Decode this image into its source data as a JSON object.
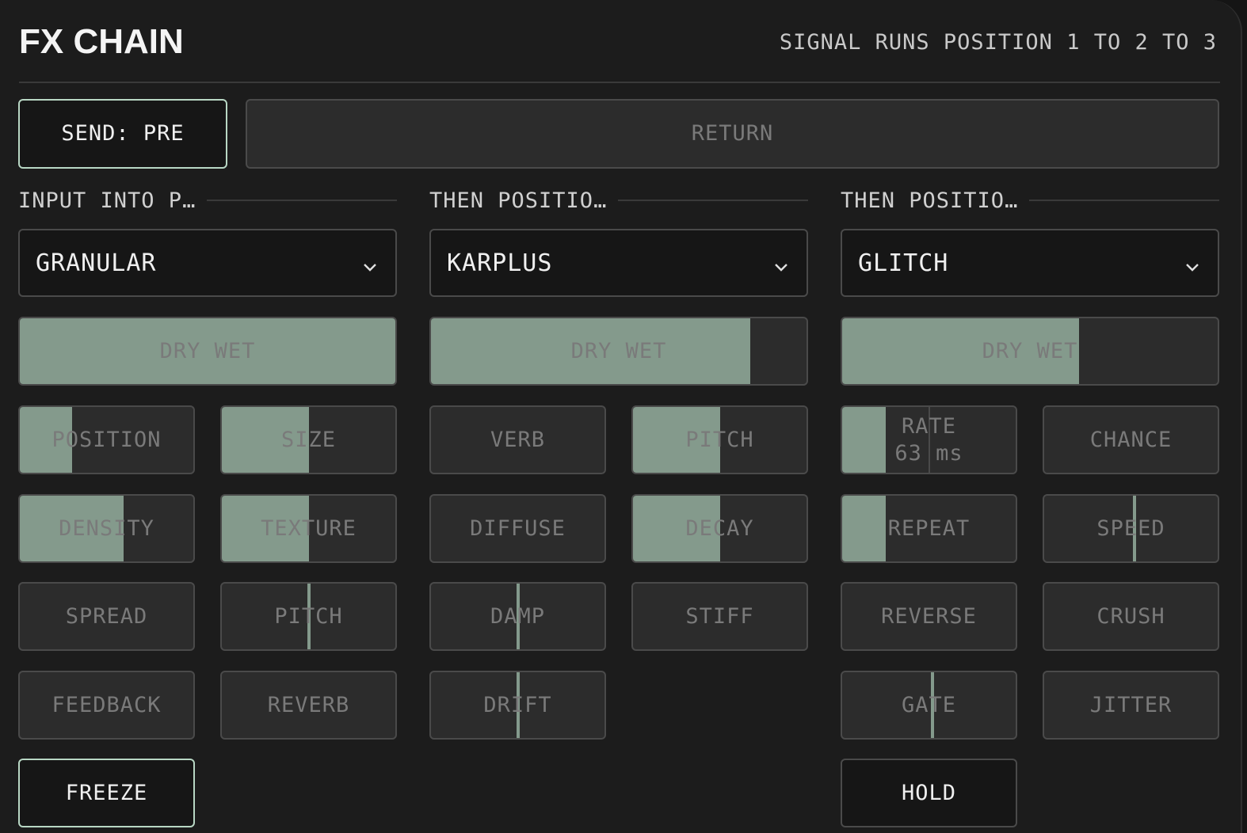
{
  "header": {
    "title": "FX CHAIN",
    "subtitle": "SIGNAL RUNS POSITION 1 TO 2 TO 3"
  },
  "routing": {
    "send_label": "SEND: PRE",
    "return_label": "RETURN"
  },
  "slots": [
    {
      "heading": "INPUT INTO P…",
      "effect": "GRANULAR",
      "drywet_label": "DRY WET",
      "drywet_value": 1.0,
      "params": [
        {
          "label": "POSITION",
          "value": 0.3,
          "display": "fill"
        },
        {
          "label": "SIZE",
          "value": 0.5,
          "display": "fill"
        },
        {
          "label": "DENSITY",
          "value": 0.6,
          "display": "fill"
        },
        {
          "label": "TEXTURE",
          "value": 0.5,
          "display": "fill"
        },
        {
          "label": "SPREAD",
          "value": 0.0,
          "display": "none"
        },
        {
          "label": "PITCH",
          "value": 0.5,
          "display": "marker"
        },
        {
          "label": "FEEDBACK",
          "value": 0.0,
          "display": "none"
        },
        {
          "label": "REVERB",
          "value": 0.0,
          "display": "none"
        }
      ],
      "toggle": "FREEZE"
    },
    {
      "heading": "THEN POSITIO…",
      "effect": "KARPLUS",
      "drywet_label": "DRY WET",
      "drywet_value": 0.85,
      "params": [
        {
          "label": "VERB",
          "value": 0.0,
          "display": "none"
        },
        {
          "label": "PITCH",
          "value": 0.5,
          "display": "fill"
        },
        {
          "label": "DIFFUSE",
          "value": 0.0,
          "display": "none"
        },
        {
          "label": "DECAY",
          "value": 0.5,
          "display": "fill"
        },
        {
          "label": "DAMP",
          "value": 0.5,
          "display": "marker"
        },
        {
          "label": "STIFF",
          "value": 0.0,
          "display": "none"
        },
        {
          "label": "DRIFT",
          "value": 0.5,
          "display": "marker"
        }
      ]
    },
    {
      "heading": "THEN POSITIO…",
      "effect": "GLITCH",
      "drywet_label": "DRY WET",
      "drywet_value": 0.63,
      "params": [
        {
          "label": "RATE",
          "sublabel": "63 ms",
          "value": 0.25,
          "display": "fill",
          "marker_value": 0.5
        },
        {
          "label": "CHANCE",
          "value": 0.0,
          "display": "none"
        },
        {
          "label": "REPEAT",
          "value": 0.25,
          "display": "fill"
        },
        {
          "label": "SPEED",
          "value": 0.52,
          "display": "marker"
        },
        {
          "label": "REVERSE",
          "value": 0.0,
          "display": "none"
        },
        {
          "label": "CRUSH",
          "value": 0.0,
          "display": "none"
        },
        {
          "label": "GATE",
          "value": 0.52,
          "display": "marker"
        },
        {
          "label": "JITTER",
          "value": 0.0,
          "display": "none"
        }
      ],
      "toggle": "HOLD"
    }
  ],
  "colors": {
    "accent_fill": "#849a8c",
    "active_border": "#b8d7c4",
    "panel": "#1c1c1c"
  },
  "icons": {
    "dropdown": "chevron-down-icon"
  }
}
